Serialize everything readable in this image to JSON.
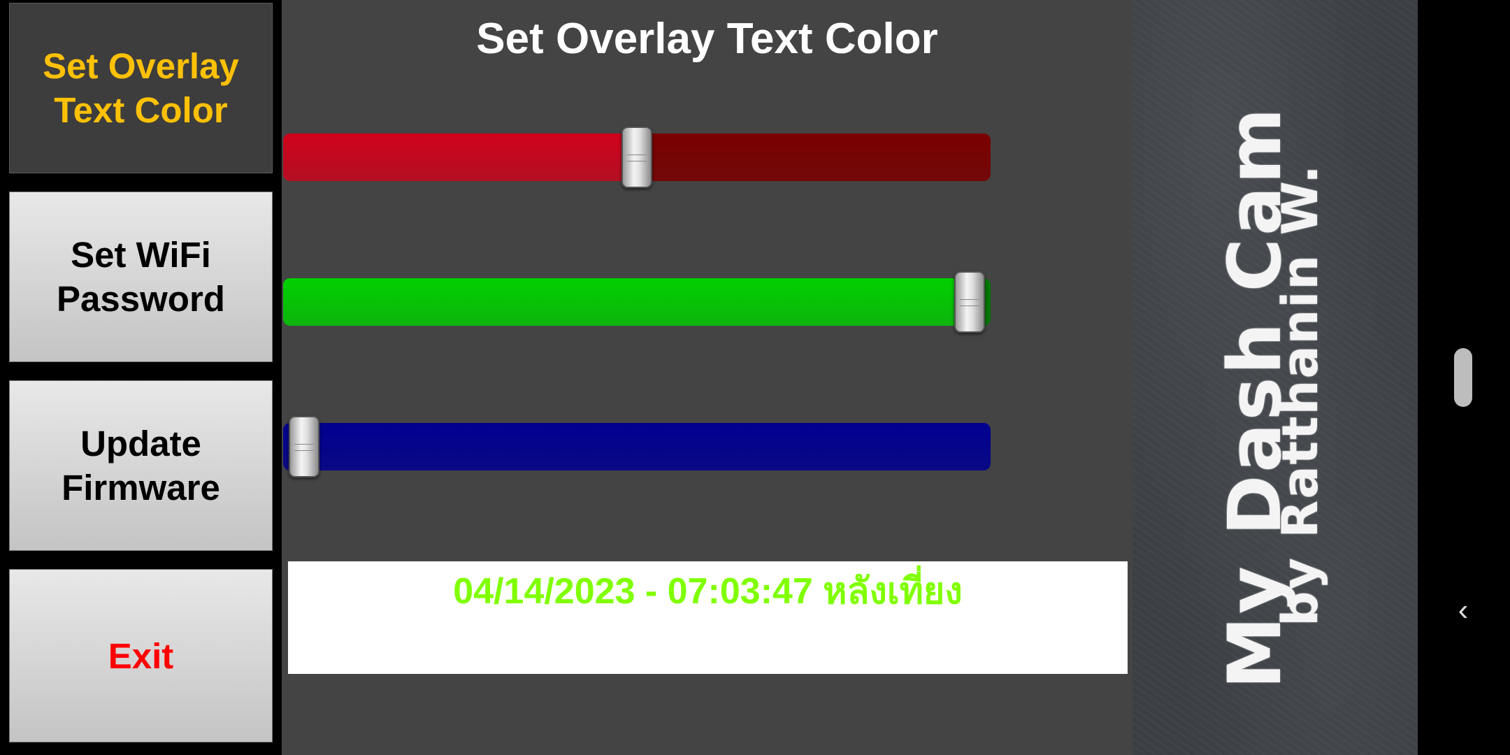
{
  "menu": {
    "items": [
      {
        "label": "Set Overlay\nText Color",
        "active": true,
        "color": "#FFC107"
      },
      {
        "label": "Set WiFi\nPassword",
        "active": false,
        "color": "#000000"
      },
      {
        "label": "Update\nFirmware",
        "active": false,
        "color": "#000000"
      },
      {
        "label": "Exit",
        "active": false,
        "color": "#FF0000"
      }
    ]
  },
  "main": {
    "title": "Set Overlay Text Color",
    "sliders": [
      {
        "channel": "red",
        "level": 0.5,
        "color": "#D0021B",
        "dark_color": "#7A0000"
      },
      {
        "channel": "green",
        "level": 0.97,
        "color": "#00D000",
        "dark_color": "#007A00"
      },
      {
        "channel": "blue",
        "level": 0.03,
        "color": "#000090",
        "dark_color": "#000090"
      }
    ],
    "preview": {
      "text": "04/14/2023 - 07:03:47 หลังเที่ยง",
      "color": "#80FF00"
    }
  },
  "board": {
    "title": "My Dash Cam",
    "author": "by Ratthanin W."
  },
  "sysbar": {
    "back_icon": "chevron-left-icon"
  }
}
